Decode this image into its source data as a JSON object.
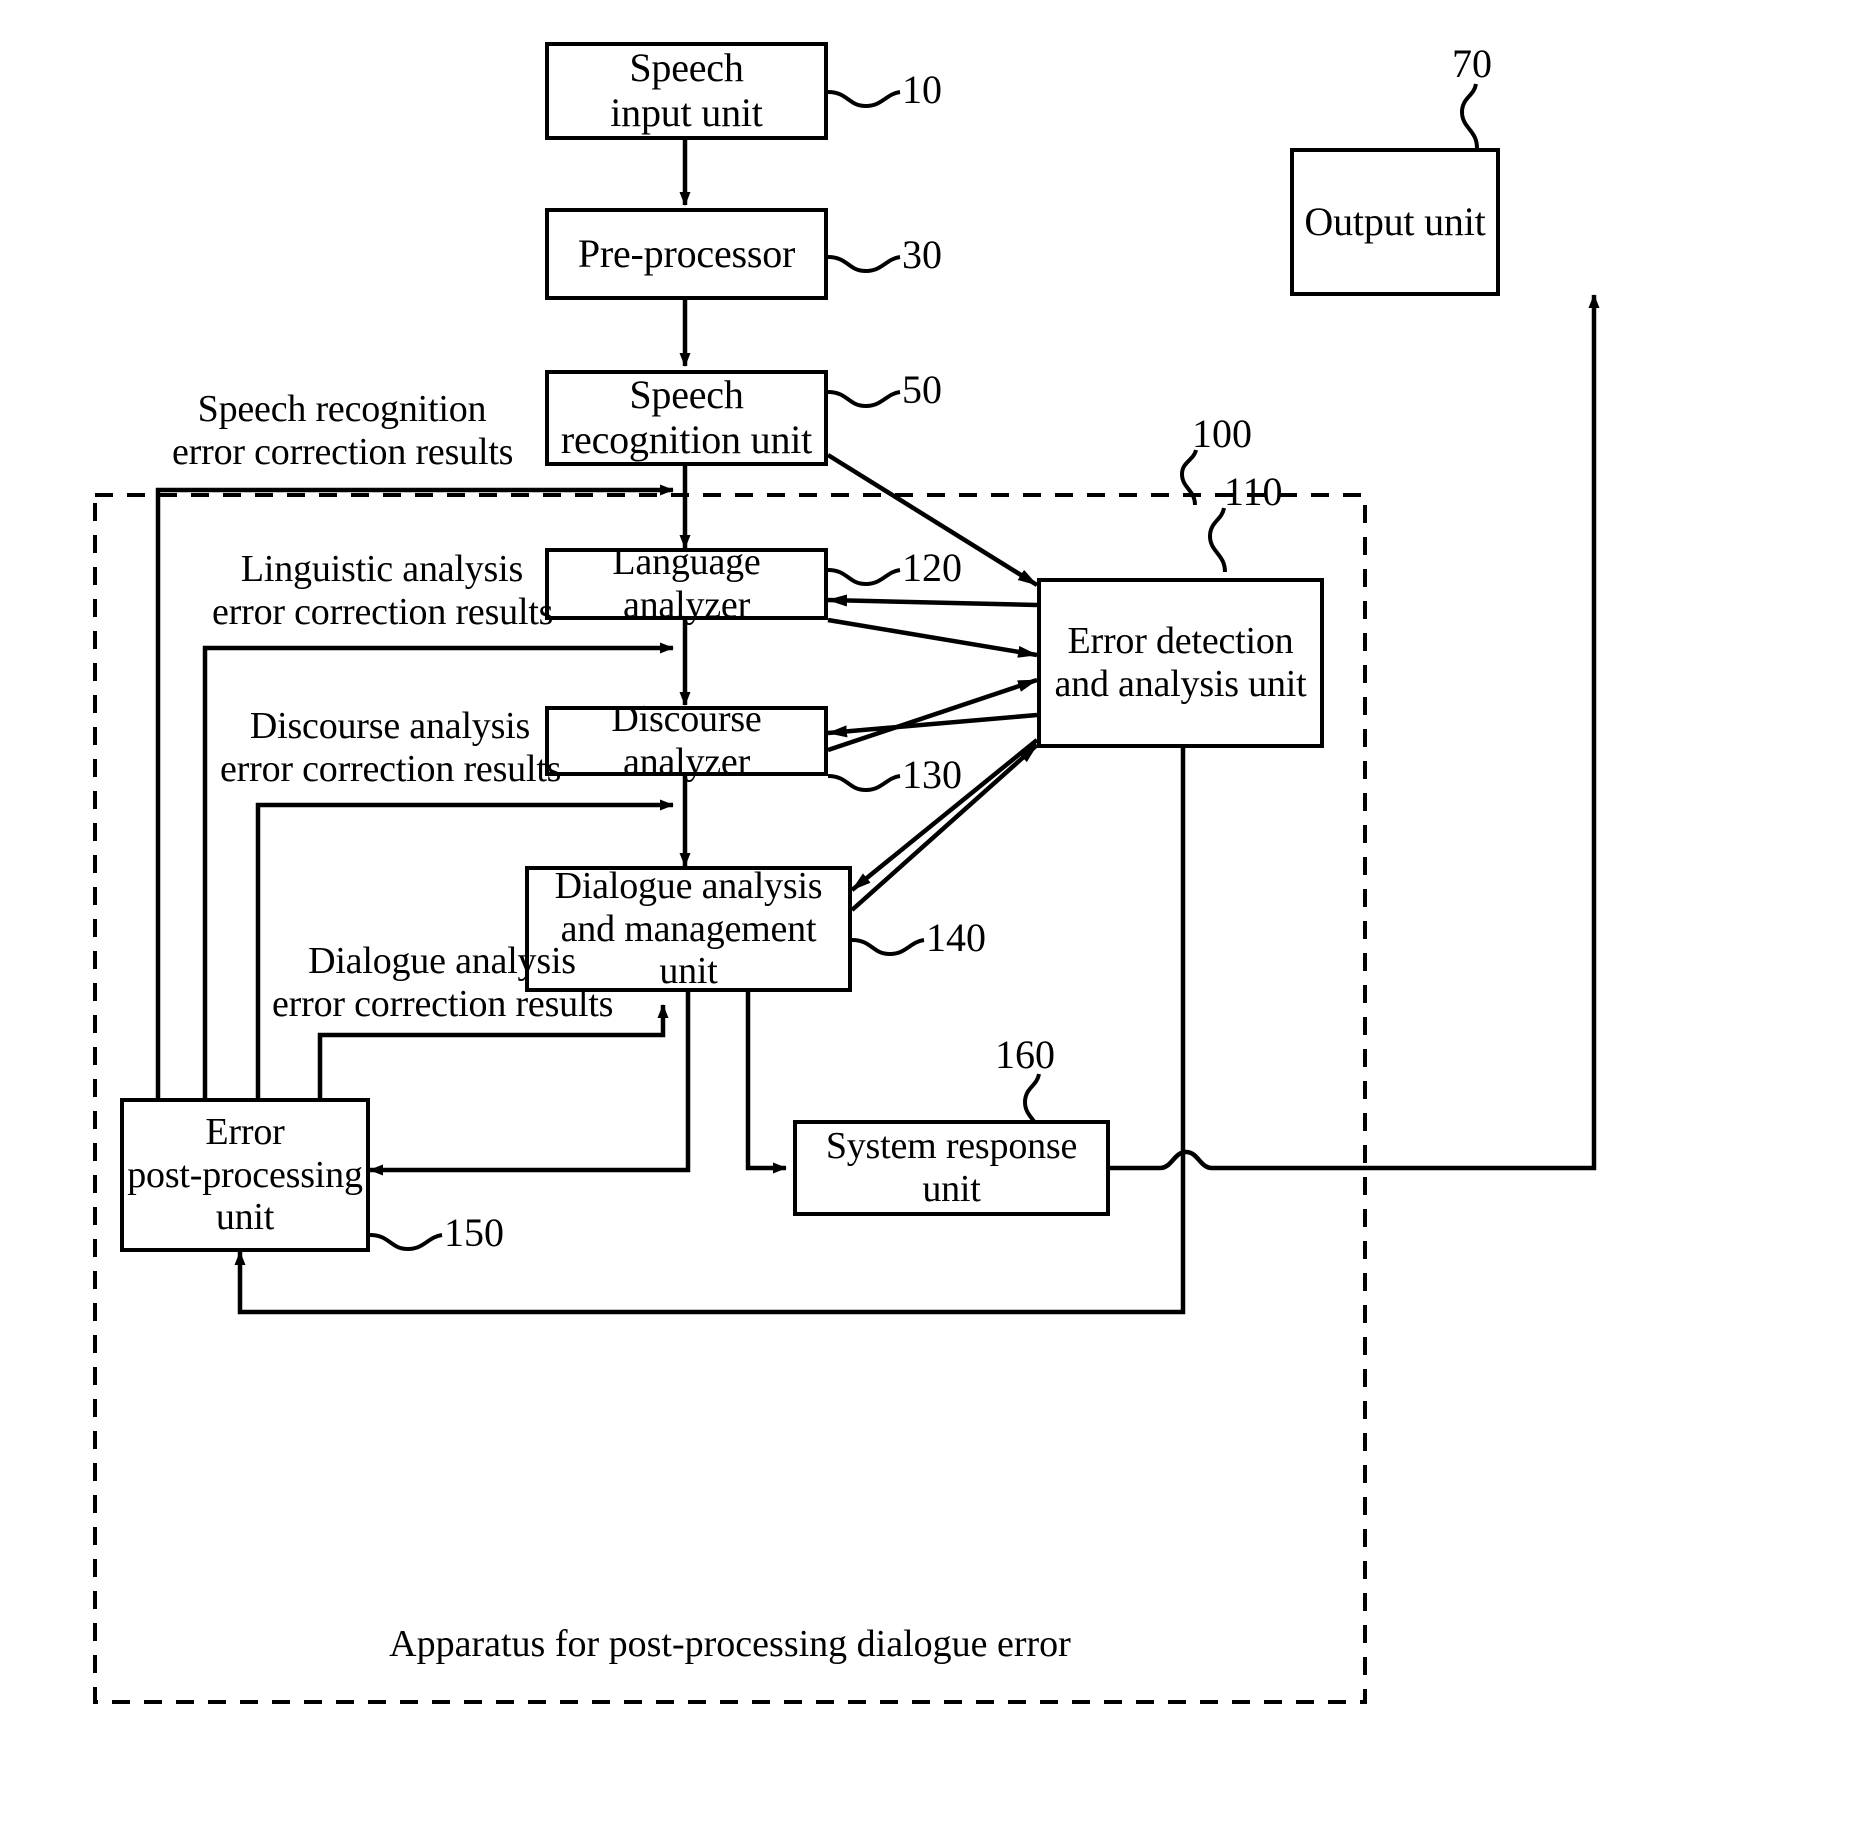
{
  "figure": {
    "caption": "Apparatus for post-processing dialogue error",
    "container_ref": "100"
  },
  "boxes": [
    {
      "id": "speech-input-unit",
      "text": "Speech\ninput unit",
      "ref": "10"
    },
    {
      "id": "pre-processor",
      "text": "Pre-processor",
      "ref": "30"
    },
    {
      "id": "speech-recognition-unit",
      "text": "Speech\nrecognition unit",
      "ref": "50"
    },
    {
      "id": "output-unit",
      "text": "Output unit",
      "ref": "70"
    },
    {
      "id": "language-analyzer",
      "text": "Language analyzer",
      "ref": "120"
    },
    {
      "id": "discourse-analyzer",
      "text": "Discourse analyzer",
      "ref": "130"
    },
    {
      "id": "dialogue-analysis-unit",
      "text": "Dialogue analysis\nand management unit",
      "ref": "140"
    },
    {
      "id": "error-detection-unit",
      "text": "Error detection\nand analysis unit",
      "ref": "110"
    },
    {
      "id": "error-post-processing-unit",
      "text": "Error\npost-processing\nunit",
      "ref": "150"
    },
    {
      "id": "system-response-unit",
      "text": "System response unit",
      "ref": "160"
    }
  ],
  "feedback_labels": [
    {
      "id": "speech-recognition-feedback",
      "text": "Speech recognition\nerror correction results"
    },
    {
      "id": "linguistic-analysis-feedback",
      "text": "Linguistic analysis\nerror correction results"
    },
    {
      "id": "discourse-analysis-feedback",
      "text": "Discourse analysis\nerror correction results"
    },
    {
      "id": "dialogue-analysis-feedback",
      "text": "Dialogue analysis\nerror correction results"
    }
  ],
  "ref_numbers": {
    "speech_input": "10",
    "pre_processor": "30",
    "speech_recognition": "50",
    "output": "70",
    "apparatus": "100",
    "error_detection": "110",
    "language_analyzer": "120",
    "discourse_analyzer": "130",
    "dialogue_unit": "140",
    "error_post_processing": "150",
    "system_response": "160"
  },
  "colors": {
    "stroke": "#000000",
    "background": "#ffffff"
  }
}
